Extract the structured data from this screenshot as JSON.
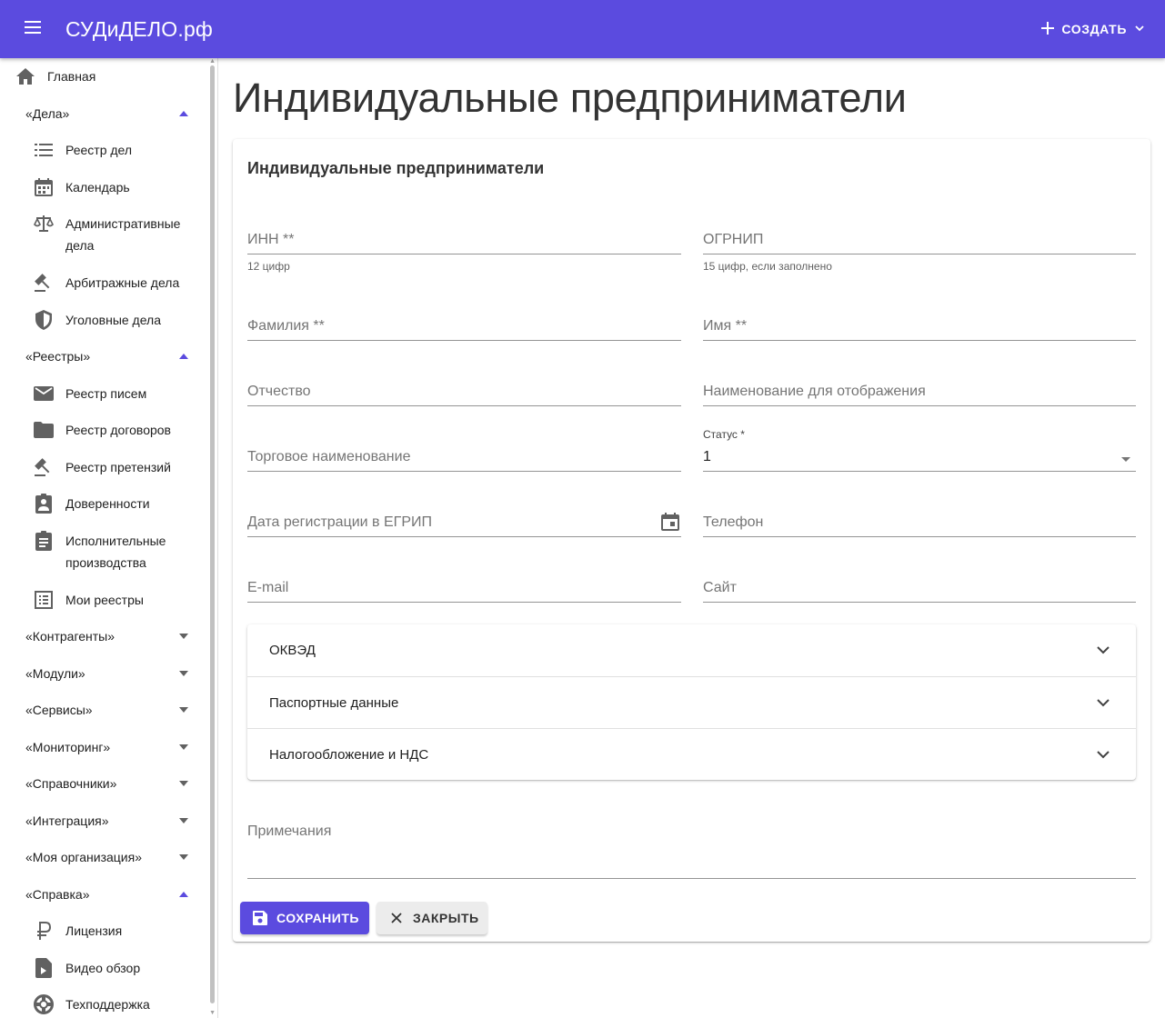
{
  "app": {
    "title": "СУДиДЕЛО.рф",
    "create_label": "СОЗДАТЬ"
  },
  "sidebar": {
    "home": "Главная",
    "groups": {
      "cases": "«Дела»",
      "registries": "«Реестры»",
      "counterparties": "«Контрагенты»",
      "modules": "«Модули»",
      "services": "«Сервисы»",
      "monitoring": "«Мониторинг»",
      "references": "«Справочники»",
      "integration": "«Интеграция»",
      "my_org": "«Моя организация»",
      "help": "«Справка»"
    },
    "cases_items": {
      "register": "Реестр дел",
      "calendar": "Календарь",
      "admin_1": "Административные",
      "admin_2": "дела",
      "arbitration": "Арбитражные дела",
      "criminal": "Уголовные дела"
    },
    "registries_items": {
      "letters": "Реестр писем",
      "contracts": "Реестр договоров",
      "claims": "Реестр претензий",
      "poa": "Доверенности",
      "exec_1": "Исполнительные",
      "exec_2": "производства",
      "mine": "Мои реестры"
    },
    "help_items": {
      "license": "Лицензия",
      "video": "Видео обзор",
      "support": "Техподдержка"
    }
  },
  "page": {
    "title": "Индивидуальные предприниматели"
  },
  "card": {
    "title": "Индивидуальные предприниматели",
    "fields": {
      "inn": "ИНН **",
      "inn_helper": "12 цифр",
      "ogrnip": "ОГРНИП",
      "ogrnip_helper": "15 цифр, если заполнено",
      "surname": "Фамилия **",
      "name": "Имя **",
      "patronymic": "Отчество",
      "display_name": "Наименование для отображения",
      "trade_name": "Торговое наименование",
      "status_label": "Статус *",
      "status_value": "1",
      "reg_date": "Дата регистрации в ЕГРИП",
      "phone": "Телефон",
      "email": "E-mail",
      "site": "Сайт",
      "notes": "Примечания"
    },
    "accordion": [
      "ОКВЭД",
      "Паспортные данные",
      "Налогообложение и НДС"
    ],
    "buttons": {
      "save": "СОХРАНИТЬ",
      "close": "ЗАКРЫТЬ"
    }
  },
  "colors": {
    "primary": "#5b4bdf",
    "icon": "#616161"
  }
}
